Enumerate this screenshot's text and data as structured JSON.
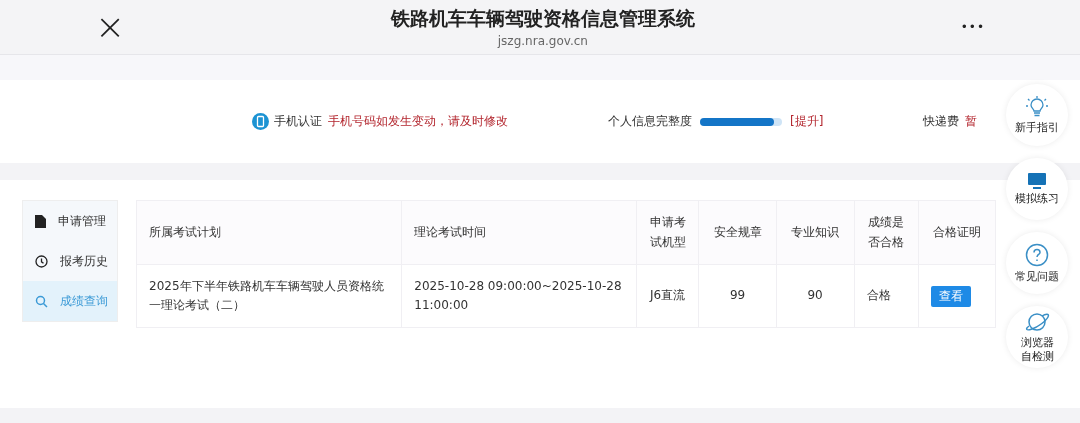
{
  "title_bar": {
    "close": "×",
    "title": "铁路机车车辆驾驶资格信息管理系统",
    "url": "jszg.nra.gov.cn",
    "more": "•••"
  },
  "info_bar": {
    "phone_label": "手机认证",
    "phone_notice": "手机号码如发生变动，请及时修改",
    "completeness_label": "个人信息完整度",
    "completeness": {
      "level": 0.9
    },
    "improve_link": "[提升]",
    "fee_label": "快递费",
    "fee_value": "暂"
  },
  "sidebar": {
    "items": [
      {
        "label": "申请管理",
        "selected": false
      },
      {
        "label": "报考历史",
        "selected": false
      },
      {
        "label": "成绩查询",
        "selected": true
      }
    ]
  },
  "table": {
    "columns": [
      "所属考试计划",
      "理论考试时间",
      "申请考试机型",
      "安全规章",
      "专业知识",
      "成绩是否合格",
      "合格证明"
    ],
    "rows": [
      {
        "cells": [
          "2025年下半年铁路机车车辆驾驶人员资格统一理论考试（二）",
          "2025-10-28 09:00:00~2025-10-28 11:00:00",
          "J6直流",
          "99",
          "90",
          "合格"
        ],
        "action": "查看"
      }
    ]
  },
  "float_menu": [
    {
      "label": "新手指引"
    },
    {
      "label": "模拟练习"
    },
    {
      "label": "常见问题"
    },
    {
      "label": "浏览器自检测"
    }
  ]
}
